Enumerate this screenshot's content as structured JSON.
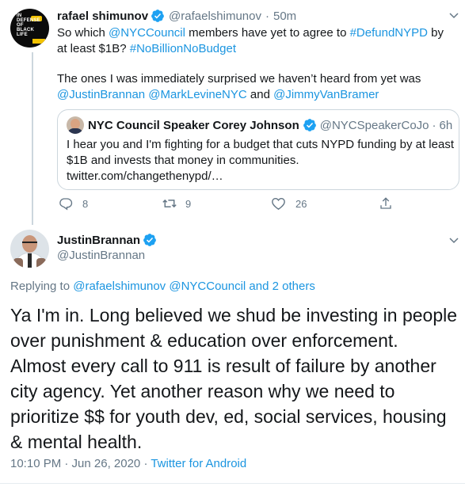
{
  "tweet1": {
    "author_name": "rafael shimunov",
    "author_handle": "@rafaelshimunov",
    "time_sep": "·",
    "time": "50m",
    "avatar_text": "IN DEFENSE OF BLACK LIFE",
    "body_line1_prefix": "So which ",
    "body_mention1": "@NYCCouncil",
    "body_line1_mid": " members have yet to agree to ",
    "body_hashtag1": "#DefundNYPD",
    "body_line1_suffix": " by at least $1B? ",
    "body_hashtag2": "#NoBillionNoBudget",
    "body_para2": "The ones I was immediately surprised we haven’t heard from yet was",
    "body_mention2": "@JustinBrannan",
    "body_mention3": "@MarkLevineNYC",
    "body_and": " and ",
    "body_mention4": "@JimmyVanBramer",
    "quote": {
      "author_name": "NYC Council Speaker Corey Johnson",
      "author_handle": "@NYCSpeakerCoJo",
      "time_sep": "·",
      "time": "6h",
      "body": "I hear you and I'm fighting for a budget that cuts NYPD funding by at least $1B and invests that money in communities.",
      "link": "twitter.com/changethenypd/…"
    },
    "actions": {
      "reply_count": "8",
      "retweet_count": "9",
      "like_count": "26"
    }
  },
  "tweet2": {
    "author_name": "JustinBrannan",
    "author_handle": "@JustinBrannan",
    "replying_prefix": "Replying to ",
    "replying_mention1": "@rafaelshimunov",
    "replying_mention2": "@NYCCouncil",
    "replying_and": " and ",
    "replying_others": "2 others",
    "body": "Ya I'm in. Long believed we shud be investing in people over punishment & education over enforcement. Almost every call to 911 is result of failure by another city agency. Yet another reason why we need to prioritize $$ for youth dev, ed, social services, housing & mental health.",
    "timestamp": "10:10 PM · Jun 26, 2020",
    "meta_sep": " · ",
    "source": "Twitter for Android"
  },
  "colors": {
    "link": "#1b95e0",
    "secondary_text": "#657786",
    "border": "#ccd6dd",
    "verified": "#1da1f2"
  }
}
